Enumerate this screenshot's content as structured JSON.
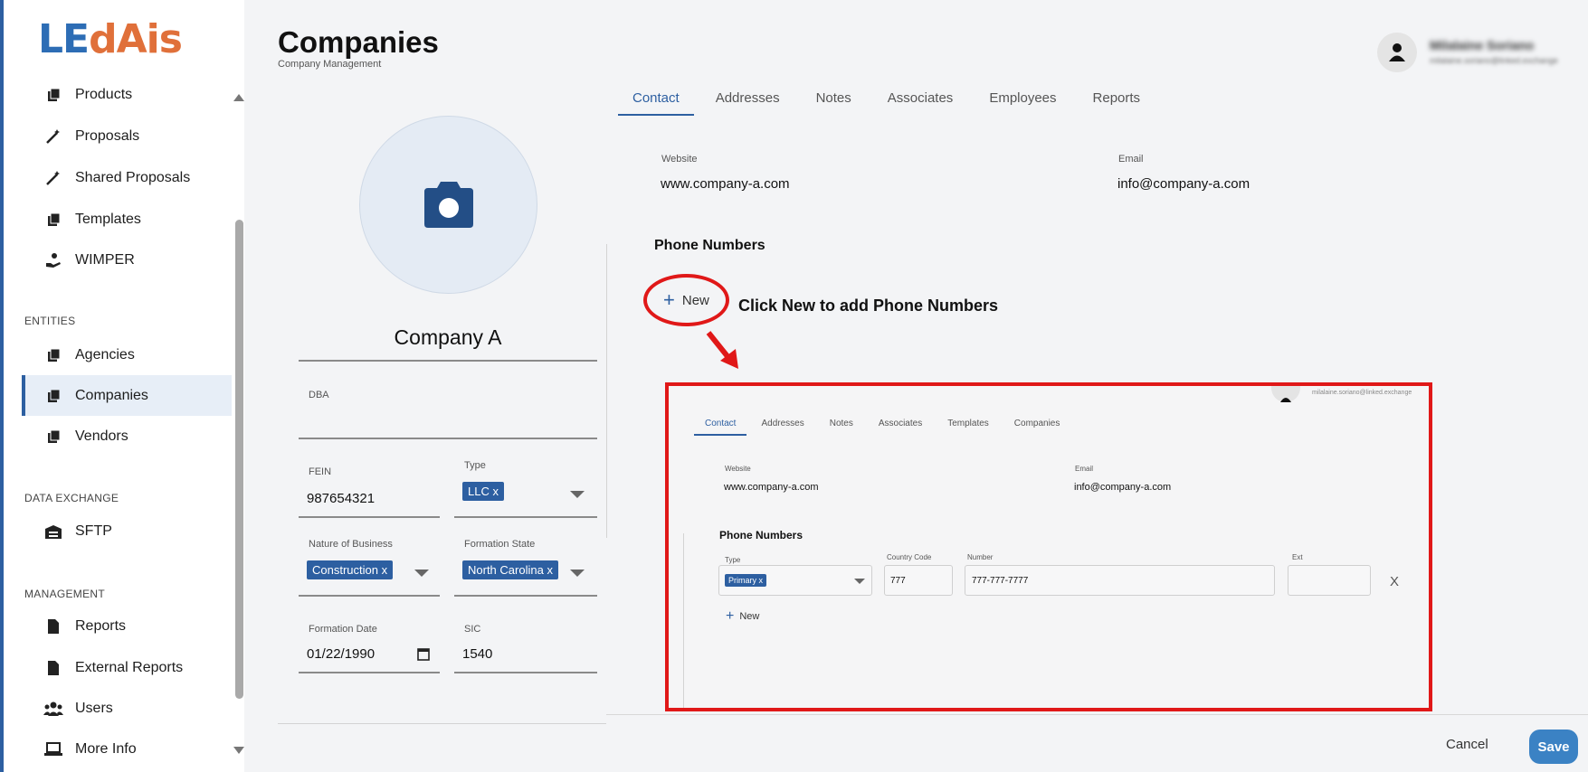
{
  "app": {
    "logo_le": "LE",
    "logo_dais": "dAis"
  },
  "sidebar": {
    "items_top": [
      {
        "label": "Products",
        "icon": "books-icon"
      },
      {
        "label": "Proposals",
        "icon": "magic-wand-icon"
      },
      {
        "label": "Shared Proposals",
        "icon": "magic-wand-icon"
      },
      {
        "label": "Templates",
        "icon": "books-icon"
      },
      {
        "label": "WIMPER",
        "icon": "hand-coin-icon"
      }
    ],
    "section_entities": "ENTITIES",
    "items_entities": [
      {
        "label": "Agencies",
        "icon": "books-icon"
      },
      {
        "label": "Companies",
        "icon": "books-icon"
      },
      {
        "label": "Vendors",
        "icon": "books-icon"
      }
    ],
    "section_data_exchange": "DATA EXCHANGE",
    "items_data_exchange": [
      {
        "label": "SFTP",
        "icon": "warehouse-icon"
      }
    ],
    "section_management": "MANAGEMENT",
    "items_management": [
      {
        "label": "Reports",
        "icon": "file-icon"
      },
      {
        "label": "External Reports",
        "icon": "file-icon"
      },
      {
        "label": "Users",
        "icon": "users-icon"
      },
      {
        "label": "More Info",
        "icon": "laptop-icon"
      }
    ]
  },
  "header": {
    "title": "Companies",
    "subtitle": "Company Management",
    "user_name": "Milalaine Soriano",
    "user_email": "milalaine.soriano@linked.exchange"
  },
  "tabs": [
    "Contact",
    "Addresses",
    "Notes",
    "Associates",
    "Employees",
    "Reports"
  ],
  "company": {
    "name": "Company A",
    "dba_label": "DBA",
    "dba_value": "",
    "fein_label": "FEIN",
    "fein_value": "987654321",
    "type_label": "Type",
    "type_chip": "LLC",
    "nature_label": "Nature of Business",
    "nature_chip": "Construction",
    "state_label": "Formation State",
    "state_chip": "North Carolina",
    "date_label": "Formation Date",
    "date_value": "01/22/1990",
    "sic_label": "SIC",
    "sic_value": "1540"
  },
  "contact": {
    "website_label": "Website",
    "website_value": "www.company-a.com",
    "email_label": "Email",
    "email_value": "info@company-a.com",
    "phone_title": "Phone Numbers",
    "new_label": "New",
    "callout": "Click New to add Phone Numbers"
  },
  "inset": {
    "tabs": [
      "Contact",
      "Addresses",
      "Notes",
      "Associates",
      "Templates",
      "Companies"
    ],
    "email_header": "milalaine.soriano@linked.exchange",
    "website_label": "Website",
    "website_value": "www.company-a.com",
    "email_label": "Email",
    "email_value": "info@company-a.com",
    "phone_title": "Phone Numbers",
    "type_label": "Type",
    "type_chip": "Primary",
    "cc_label": "Country Code",
    "cc_value": "777",
    "number_label": "Number",
    "number_value": "777-777-7777",
    "ext_label": "Ext",
    "ext_value": "",
    "remove_label": "X",
    "new_label": "New"
  },
  "footer": {
    "cancel": "Cancel",
    "save": "Save"
  },
  "colors": {
    "accent": "#2d5fa1",
    "highlight": "#e01818",
    "logo_orange": "#e0703a",
    "save": "#3b82c4"
  }
}
